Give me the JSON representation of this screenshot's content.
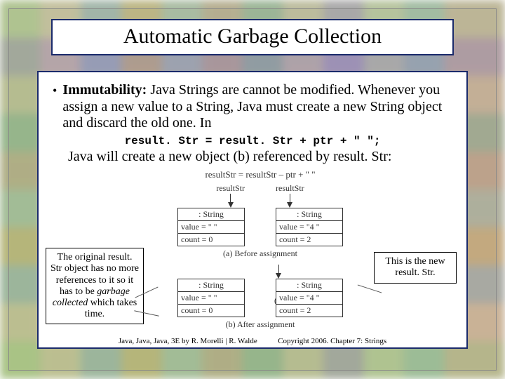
{
  "title": "Automatic Garbage Collection",
  "bullet": {
    "lead": "Immutability:",
    "rest": " Java Strings are cannot be modified. Whenever you assign a new value to a String, Java must create a new String object and discard the old one. In"
  },
  "code": "result. Str = result. Str + ptr + \" \";",
  "cont": "Java will create a new object (b) referenced by result. Str:",
  "diag": {
    "topcode": "resultStr = resultStr – ptr + \"  \"",
    "before": {
      "left": {
        "hdr": ": String",
        "f1": "value = \" \"",
        "f2": "count = 0"
      },
      "right": {
        "hdr": ": String",
        "f1": "value = \"4 \"",
        "f2": "count = 2"
      },
      "cap": "(a) Before assignment",
      "labL": "resultStr",
      "labR": "resultStr"
    },
    "orphan": "(Orphan object)",
    "after": {
      "left": {
        "hdr": ": String",
        "f1": "value = \" \"",
        "f2": "count = 0"
      },
      "right": {
        "hdr": ": String",
        "f1": "value = \"4 \"",
        "f2": "count = 2"
      },
      "cap": "(b) After assignment"
    }
  },
  "annot": {
    "left": {
      "t1": "The original result. Str object has no more references to it so it has to be ",
      "em": "garbage collected",
      "t2": " which takes time."
    },
    "right": "This is the new result. Str."
  },
  "footer": {
    "left": "Java, Java, Java, 3E by R. Morelli | R. Walde",
    "right": "Copyright 2006.  Chapter 7: Strings"
  }
}
